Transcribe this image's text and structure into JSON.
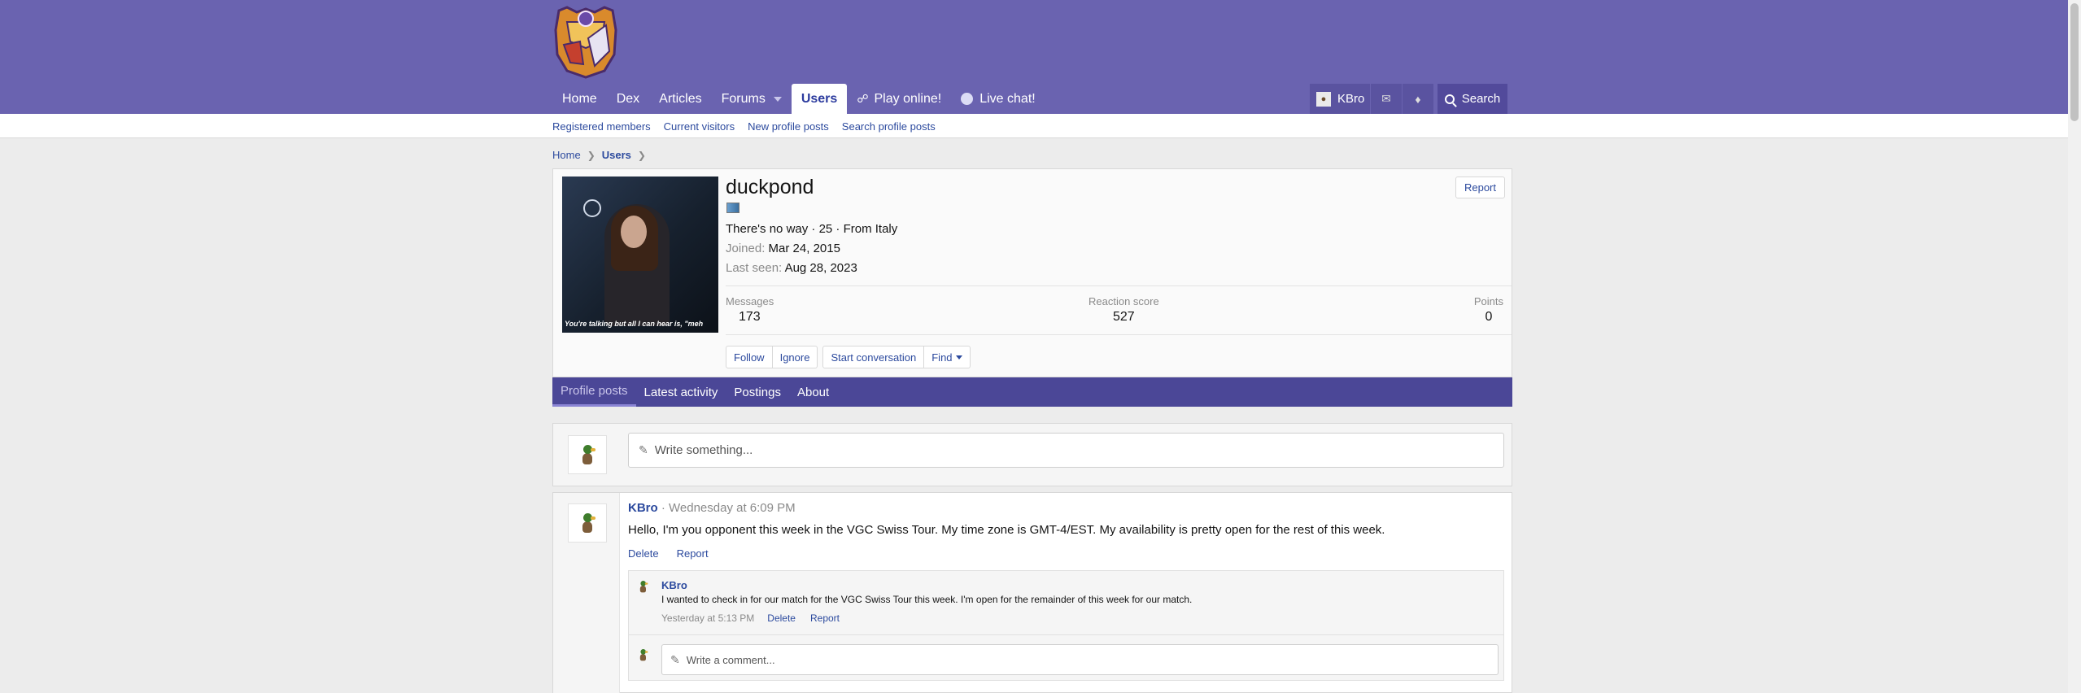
{
  "header": {
    "nav": [
      {
        "label": "Home"
      },
      {
        "label": "Dex"
      },
      {
        "label": "Articles"
      },
      {
        "label": "Forums"
      },
      {
        "label": "Users",
        "active": true
      },
      {
        "label": "Play online!"
      },
      {
        "label": "Live chat!"
      }
    ],
    "account": {
      "username": "KBro"
    },
    "search_label": "Search",
    "colors": {
      "header_bg": "#6a63b0",
      "tabs_bg": "#4b4797",
      "link": "#2c4a9e"
    }
  },
  "subnav": [
    "Registered members",
    "Current visitors",
    "New profile posts",
    "Search profile posts"
  ],
  "breadcrumb": [
    "Home",
    "Users"
  ],
  "profile": {
    "username": "duckpond",
    "blurb": "There's no way · 25 · From Italy",
    "joined_label": "Joined:",
    "joined": "Mar 24, 2015",
    "last_seen_label": "Last seen:",
    "last_seen": "Aug 28, 2023",
    "avatar_caption": "You're talking but all I can hear is, \"meh",
    "report_label": "Report",
    "stats": [
      {
        "label": "Messages",
        "value": "173"
      },
      {
        "label": "Reaction score",
        "value": "527"
      },
      {
        "label": "Points",
        "value": "0"
      }
    ],
    "actions": {
      "follow": "Follow",
      "ignore": "Ignore",
      "start_conversation": "Start conversation",
      "find": "Find"
    }
  },
  "tabs": [
    {
      "label": "Profile posts",
      "active": true
    },
    {
      "label": "Latest activity"
    },
    {
      "label": "Postings"
    },
    {
      "label": "About"
    }
  ],
  "composer": {
    "placeholder": "Write something..."
  },
  "post": {
    "author": "KBro",
    "time": "Wednesday at 6:09 PM",
    "body": "Hello, I'm you opponent this week in the VGC Swiss Tour. My time zone is GMT-4/EST. My availability is pretty open for the rest of this week.",
    "delete_label": "Delete",
    "report_label": "Report",
    "comment": {
      "author": "KBro",
      "text": "I wanted to check in for our match for the VGC Swiss Tour this week. I'm open for the remainder of this week for our match.",
      "time": "Yesterday at 5:13 PM",
      "delete_label": "Delete",
      "report_label": "Report"
    },
    "comment_placeholder": "Write a comment..."
  }
}
